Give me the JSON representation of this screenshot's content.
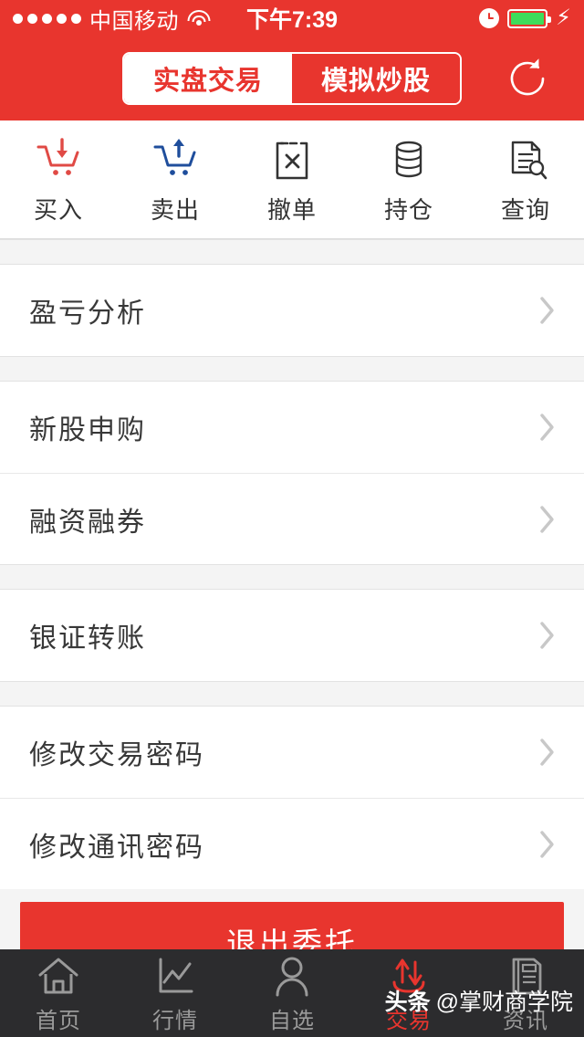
{
  "status_bar": {
    "signal_dots": 5,
    "carrier": "中国移动",
    "wifi_icon": "wifi-icon",
    "time": "下午7:39",
    "alarm_icon": "alarm-clock-icon",
    "battery_icon": "battery-full-icon",
    "charging_icon": "lightning-bolt-icon",
    "battery_color": "#3ddc5b",
    "background_color": "#e8352e"
  },
  "header": {
    "tabs": [
      {
        "label": "实盘交易",
        "active": true
      },
      {
        "label": "模拟炒股",
        "active": false
      }
    ],
    "refresh_icon": "refresh-icon",
    "accent_color": "#e8352e"
  },
  "quick_actions": [
    {
      "label": "买入",
      "icon": "cart-download-icon",
      "color": "#e04a45"
    },
    {
      "label": "卖出",
      "icon": "cart-upload-icon",
      "color": "#1f4e9c"
    },
    {
      "label": "撤单",
      "icon": "clipboard-cancel-icon",
      "color": "#333333"
    },
    {
      "label": "持仓",
      "icon": "database-stack-icon",
      "color": "#333333"
    },
    {
      "label": "查询",
      "icon": "document-search-icon",
      "color": "#333333"
    }
  ],
  "menu_sections": [
    {
      "items": [
        {
          "label": "盈亏分析",
          "chevron_icon": "chevron-right-icon"
        }
      ]
    },
    {
      "items": [
        {
          "label": "新股申购",
          "chevron_icon": "chevron-right-icon"
        },
        {
          "label": "融资融券",
          "chevron_icon": "chevron-right-icon"
        }
      ]
    },
    {
      "items": [
        {
          "label": "银证转账",
          "chevron_icon": "chevron-right-icon"
        }
      ]
    },
    {
      "items": [
        {
          "label": "修改交易密码",
          "chevron_icon": "chevron-right-icon"
        },
        {
          "label": "修改通讯密码",
          "chevron_icon": "chevron-right-icon"
        }
      ]
    }
  ],
  "logout": {
    "label": "退出委托",
    "color": "#e8352e"
  },
  "tab_bar": [
    {
      "label": "首页",
      "icon": "home-icon",
      "active": false
    },
    {
      "label": "行情",
      "icon": "chart-line-icon",
      "active": false
    },
    {
      "label": "自选",
      "icon": "person-icon",
      "active": false
    },
    {
      "label": "交易",
      "icon": "transfer-arrows-icon",
      "active": true
    },
    {
      "label": "资讯",
      "icon": "news-icon",
      "active": false
    }
  ],
  "watermark": {
    "badge": "头条",
    "text": "@掌财商学院"
  }
}
